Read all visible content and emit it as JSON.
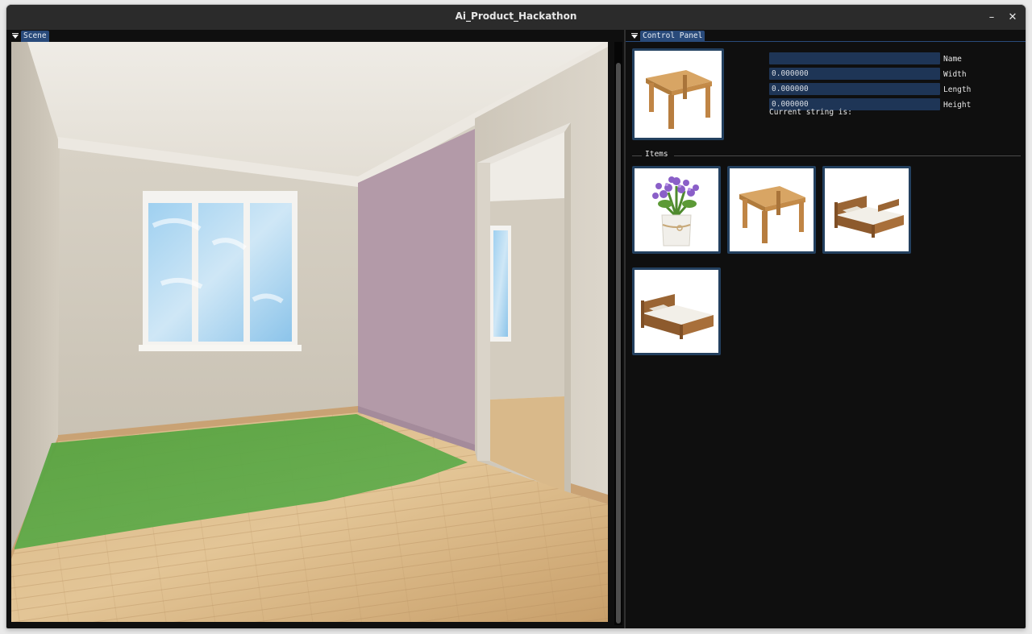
{
  "window": {
    "title": "Ai_Product_Hackathon",
    "minimize_label": "–",
    "close_label": "✕"
  },
  "scene_panel": {
    "tab_label": "Scene"
  },
  "control_panel": {
    "tab_label": "Control Panel",
    "selected_item_icon": "table-icon",
    "fields": [
      {
        "label": "Name",
        "value": ""
      },
      {
        "label": "Width",
        "value": "0.000000"
      },
      {
        "label": "Length",
        "value": "0.000000"
      },
      {
        "label": "Height",
        "value": "0.000000"
      }
    ],
    "current_string_label": "Current string is:",
    "items_section_label": "Items",
    "items": [
      {
        "icon": "flower-pot-icon"
      },
      {
        "icon": "table-icon"
      },
      {
        "icon": "bed-icon"
      },
      {
        "icon": "bed-icon"
      }
    ]
  },
  "colors": {
    "accent": "#294a7a",
    "field_bg": "#1e3556",
    "panel_bg": "#0f0f0f",
    "floor_highlight": "#5fa84a",
    "feature_wall": "#b39aa8"
  }
}
